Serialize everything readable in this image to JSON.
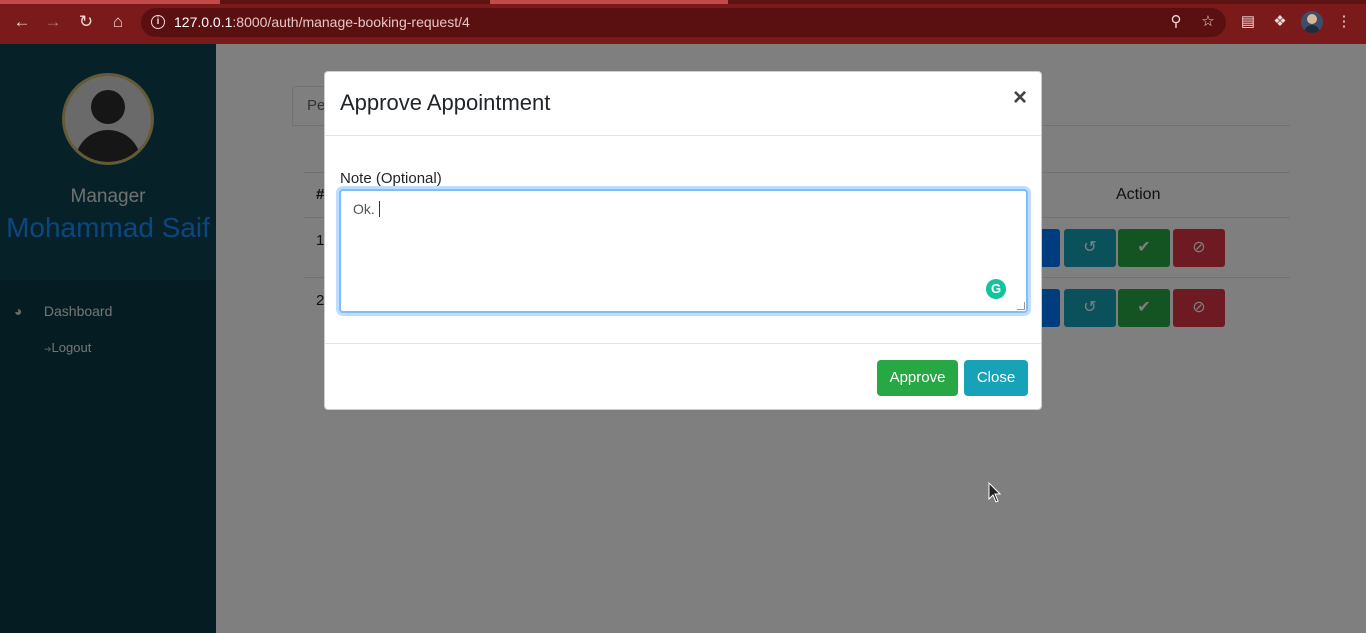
{
  "browser": {
    "url_host": "127.0.0.1",
    "url_path": ":8000/auth/manage-booking-request/4",
    "icons": [
      "back-icon",
      "forward-icon",
      "reload-icon",
      "home-icon",
      "info-icon",
      "zoom-icon",
      "star-icon",
      "reading-list-icon",
      "extensions-icon",
      "profile-avatar",
      "menu-icon"
    ]
  },
  "sidebar": {
    "role": "Manager",
    "user_name": "Mohammad Saif",
    "items": [
      {
        "label": "Dashboard",
        "icon": "tachometer-icon"
      },
      {
        "label": "Logout",
        "icon": "sign-out-icon"
      }
    ]
  },
  "main": {
    "tab_label": "Pe",
    "table": {
      "header_hash": "#",
      "header_action": "Action",
      "rows": [
        {
          "num": "1"
        },
        {
          "num": "2"
        }
      ]
    }
  },
  "modal": {
    "title": "Approve Appointment",
    "close_symbol": "×",
    "note_label": "Note (Optional)",
    "note_value": "Ok.",
    "approve_label": "Approve",
    "close_label": "Close"
  },
  "colors": {
    "chrome": "#7b1a1a",
    "sidebar": "#0a3a44",
    "approve": "#28a745",
    "close": "#17a2b8",
    "danger": "#dc3545",
    "primary": "#007bff"
  }
}
